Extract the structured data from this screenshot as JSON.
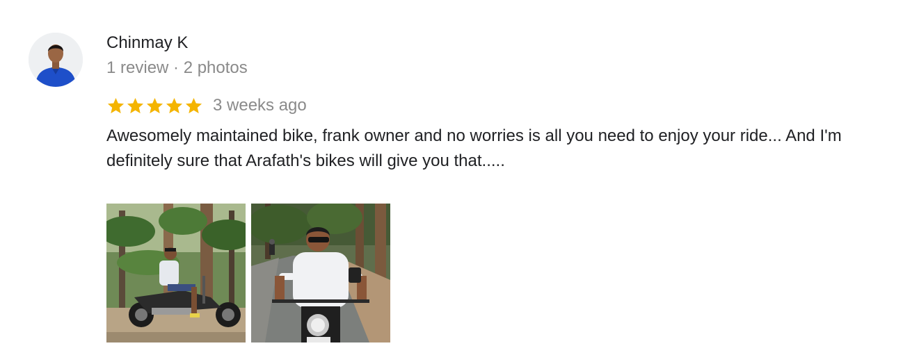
{
  "reviewer": {
    "name": "Chinmay K",
    "meta": "1 review · 2 photos",
    "avatar_icon": "person-avatar-icon"
  },
  "rating": {
    "stars": 5,
    "max_stars": 5,
    "star_color": "#F4B400",
    "time_ago": "3 weeks ago"
  },
  "review_text": "Awesomely maintained bike, frank owner and no worries is all you need to enjoy your ride... And I'm definitely sure that Arafath's bikes will give you that.....",
  "colors": {
    "name_text": "#202124",
    "secondary_text": "#8A8A8A",
    "avatar_shirt": "#1E4FC9"
  }
}
